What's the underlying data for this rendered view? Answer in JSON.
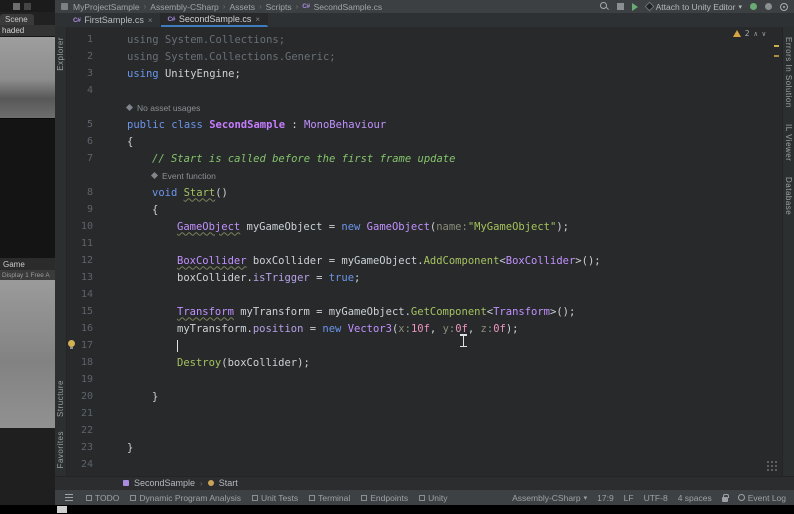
{
  "unity": {
    "scene_tab": "Scene",
    "shade_dropdown": "haded",
    "game_tab": "Game",
    "game_toolbar": "Display 1   Free A"
  },
  "titlebar": {
    "crumbs": [
      "MyProjectSample",
      "Assembly-CSharp",
      "Assets",
      "Scripts",
      "SecondSample.cs"
    ],
    "attach_label": "Attach to Unity Editor",
    "attach_dropdown": "▾"
  },
  "tabs": {
    "items": [
      {
        "label": "FirstSample.cs",
        "close": "×"
      },
      {
        "label": "SecondSample.cs",
        "close": "×"
      }
    ],
    "file_icon": "C#"
  },
  "stripes": {
    "explorer": "Explorer",
    "structure": "Structure",
    "favorites": "Favorites",
    "errors": "Errors In Solution",
    "il_viewer": "IL Viewer",
    "database": "Database"
  },
  "inspection": {
    "warning_count": "2",
    "prev": "∧",
    "next": "∨"
  },
  "code": {
    "rows": [
      {
        "n": "1",
        "ind": 0,
        "seg": [
          [
            "using System.Collections;",
            "dim"
          ]
        ]
      },
      {
        "n": "2",
        "ind": 0,
        "seg": [
          [
            "using System.Collections.Generic;",
            "dim"
          ]
        ]
      },
      {
        "n": "3",
        "ind": 0,
        "seg": [
          [
            "using ",
            "kw"
          ],
          [
            "UnityEngine",
            "pl"
          ],
          [
            ";",
            "pl"
          ]
        ]
      },
      {
        "n": "4",
        "ind": 0,
        "seg": []
      },
      {
        "hint": "No asset usages",
        "ind": 0
      },
      {
        "n": "5",
        "ind": 0,
        "seg": [
          [
            "public class ",
            "kw"
          ],
          [
            "SecondSample",
            "clsb"
          ],
          [
            " : ",
            "pl"
          ],
          [
            "MonoBehaviour",
            "type"
          ]
        ]
      },
      {
        "n": "6",
        "ind": 0,
        "seg": [
          [
            "{",
            "pl"
          ]
        ]
      },
      {
        "n": "7",
        "ind": 1,
        "seg": [
          [
            "// Start is called before the first frame update",
            "cmt"
          ]
        ]
      },
      {
        "hint": "Event function",
        "ind": 1
      },
      {
        "n": "8",
        "ind": 1,
        "seg": [
          [
            "void ",
            "kw"
          ],
          [
            "Start",
            "mth sq"
          ],
          [
            "()",
            "pl"
          ]
        ]
      },
      {
        "n": "9",
        "ind": 1,
        "seg": [
          [
            "{",
            "pl"
          ]
        ]
      },
      {
        "n": "10",
        "ind": 2,
        "seg": [
          [
            "GameObject",
            "type sq"
          ],
          [
            " myGameObject = ",
            "pl"
          ],
          [
            "new ",
            "kw"
          ],
          [
            "GameObject",
            "type"
          ],
          [
            "(",
            "pl"
          ],
          [
            "name:",
            "ph"
          ],
          [
            "\"MyGameObject\"",
            "str"
          ],
          [
            ");",
            "pl"
          ]
        ]
      },
      {
        "n": "11",
        "ind": 0,
        "seg": []
      },
      {
        "n": "12",
        "ind": 2,
        "seg": [
          [
            "BoxCollider",
            "type sq"
          ],
          [
            " boxCollider = myGameObject.",
            "pl"
          ],
          [
            "AddComponent",
            "mth"
          ],
          [
            "<",
            "pl"
          ],
          [
            "BoxCollider",
            "type"
          ],
          [
            ">();",
            "pl"
          ]
        ]
      },
      {
        "n": "13",
        "ind": 2,
        "seg": [
          [
            "boxCollider.",
            "pl"
          ],
          [
            "isTrigger",
            "prop"
          ],
          [
            " = ",
            "pl"
          ],
          [
            "true",
            "kw"
          ],
          [
            ";",
            "pl"
          ]
        ]
      },
      {
        "n": "14",
        "ind": 0,
        "seg": []
      },
      {
        "n": "15",
        "ind": 2,
        "seg": [
          [
            "Transform",
            "type sq"
          ],
          [
            " myTransform = myGameObject.",
            "pl"
          ],
          [
            "GetComponent",
            "mth"
          ],
          [
            "<",
            "pl"
          ],
          [
            "Transform",
            "type"
          ],
          [
            ">();",
            "pl"
          ]
        ]
      },
      {
        "n": "16",
        "ind": 2,
        "seg": [
          [
            "myTransform.",
            "pl"
          ],
          [
            "position",
            "prop"
          ],
          [
            " = ",
            "pl"
          ],
          [
            "new ",
            "kw"
          ],
          [
            "Vector3",
            "type"
          ],
          [
            "(",
            "pl"
          ],
          [
            "x:",
            "ph"
          ],
          [
            "10f",
            "num"
          ],
          [
            ", ",
            "pl"
          ],
          [
            "y:",
            "ph"
          ],
          [
            "0f",
            "num"
          ],
          [
            ", ",
            "pl"
          ],
          [
            "z:",
            "ph"
          ],
          [
            "0f",
            "num"
          ],
          [
            ");",
            "pl"
          ]
        ]
      },
      {
        "n": "17",
        "ind": 2,
        "seg": [],
        "caret": true,
        "bulb": true
      },
      {
        "n": "18",
        "ind": 2,
        "seg": [
          [
            "Destroy",
            "mth"
          ],
          [
            "(boxCollider);",
            "pl"
          ]
        ]
      },
      {
        "n": "19",
        "ind": 0,
        "seg": []
      },
      {
        "n": "20",
        "ind": 1,
        "seg": [
          [
            "}",
            "pl"
          ]
        ]
      },
      {
        "n": "21",
        "ind": 0,
        "seg": []
      },
      {
        "n": "22",
        "ind": 0,
        "seg": []
      },
      {
        "n": "23",
        "ind": 0,
        "seg": [
          [
            "}",
            "pl"
          ]
        ]
      },
      {
        "n": "24",
        "ind": 0,
        "seg": []
      }
    ]
  },
  "navbar": {
    "class_name": "SecondSample",
    "member": "Start",
    "separator": "›"
  },
  "statusbar": {
    "tools": [
      "TODO",
      "Dynamic Program Analysis",
      "Unit Tests",
      "Terminal",
      "Endpoints",
      "Unity"
    ],
    "build_config": "Assembly-CSharp",
    "caret_pos": "17:9",
    "line_ending": "LF",
    "encoding": "UTF-8",
    "indent": "4 spaces",
    "event_log": "Event Log"
  }
}
